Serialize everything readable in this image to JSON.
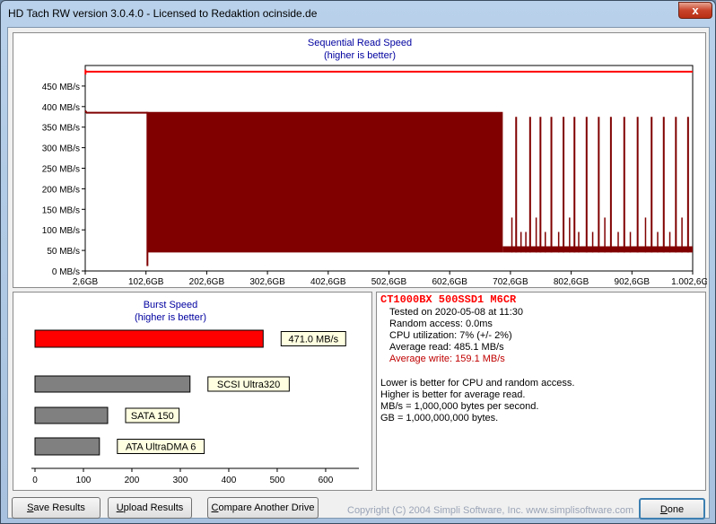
{
  "window": {
    "title": "HD Tach RW version 3.0.4.0 - Licensed to Redaktion ocinside.de",
    "close_glyph": "x"
  },
  "sequential": {
    "title": "Sequential Read Speed",
    "subtitle": "(higher is better)",
    "y_ticks": [
      "0 MB/s",
      "50 MB/s",
      "100 MB/s",
      "150 MB/s",
      "200 MB/s",
      "250 MB/s",
      "300 MB/s",
      "350 MB/s",
      "400 MB/s",
      "450 MB/s"
    ],
    "x_ticks": [
      "2,6GB",
      "102,6GB",
      "202,6GB",
      "302,6GB",
      "402,6GB",
      "502,6GB",
      "602,6GB",
      "702,6GB",
      "802,6GB",
      "902,6GB",
      "1.002,6GB"
    ]
  },
  "burst": {
    "title": "Burst Speed",
    "subtitle": "(higher is better)",
    "x_ticks": [
      "0",
      "100",
      "200",
      "300",
      "400",
      "500",
      "600"
    ]
  },
  "chart_data": [
    {
      "type": "area",
      "title": "Sequential Read Speed",
      "subtitle": "(higher is better)",
      "xlabel": "",
      "ylabel": "",
      "x_range_gb": [
        2.6,
        1002.6
      ],
      "ylim": [
        0,
        500
      ],
      "grid": false,
      "series": [
        {
          "name": "read",
          "color": "#800000",
          "x": [
            2.6,
            5,
            60,
            105,
            205,
            305,
            405,
            505,
            605,
            690,
            700,
            800,
            900,
            1002.6
          ],
          "values": [
            390,
            385,
            385,
            385,
            50,
            50,
            50,
            50,
            50,
            50,
            55,
            55,
            55,
            55
          ],
          "spike_top": [
            null,
            null,
            null,
            387,
            387,
            387,
            387,
            387,
            387,
            387,
            375,
            375,
            375,
            375
          ]
        },
        {
          "name": "access",
          "color": "#ff0000",
          "x": [
            2.6,
            1002.6
          ],
          "values": [
            485,
            485
          ]
        }
      ]
    },
    {
      "type": "bar",
      "title": "Burst Speed",
      "subtitle": "(higher is better)",
      "categories": [
        "471.0 MB/s",
        "SCSI Ultra320",
        "SATA 150",
        "ATA UltraDMA 6"
      ],
      "values": [
        471.0,
        320,
        150,
        133
      ],
      "colors": [
        "#ff0000",
        "#808080",
        "#808080",
        "#808080"
      ],
      "xlim": [
        0,
        650
      ]
    }
  ],
  "info": {
    "drive": "CT1000BX 500SSD1 M6CR",
    "tested": "Tested on 2020-05-08 at 11:30",
    "random_access": "Random access: 0.0ms",
    "cpu": "CPU utilization: 7% (+/- 2%)",
    "avg_read": "Average read: 485.1 MB/s",
    "avg_write": "Average write: 159.1 MB/s",
    "note1": "Lower is better for CPU and random access.",
    "note2": "Higher is better for average read.",
    "note3": "MB/s = 1,000,000 bytes per second.",
    "note4": "GB = 1,000,000,000 bytes."
  },
  "buttons": {
    "save": {
      "u": "S",
      "rest": "ave Results"
    },
    "upload": {
      "u": "U",
      "rest": "pload Results"
    },
    "compare": {
      "u": "C",
      "rest": "ompare Another Drive"
    },
    "done": {
      "u": "D",
      "rest": "one"
    }
  },
  "copyright": "Copyright (C) 2004 Simpli Software, Inc. www.simplisoftware.com",
  "colors": {
    "read": "#800000",
    "access": "#ff0000",
    "title_blue": "#0000a0",
    "avg_write": "#c00000"
  }
}
